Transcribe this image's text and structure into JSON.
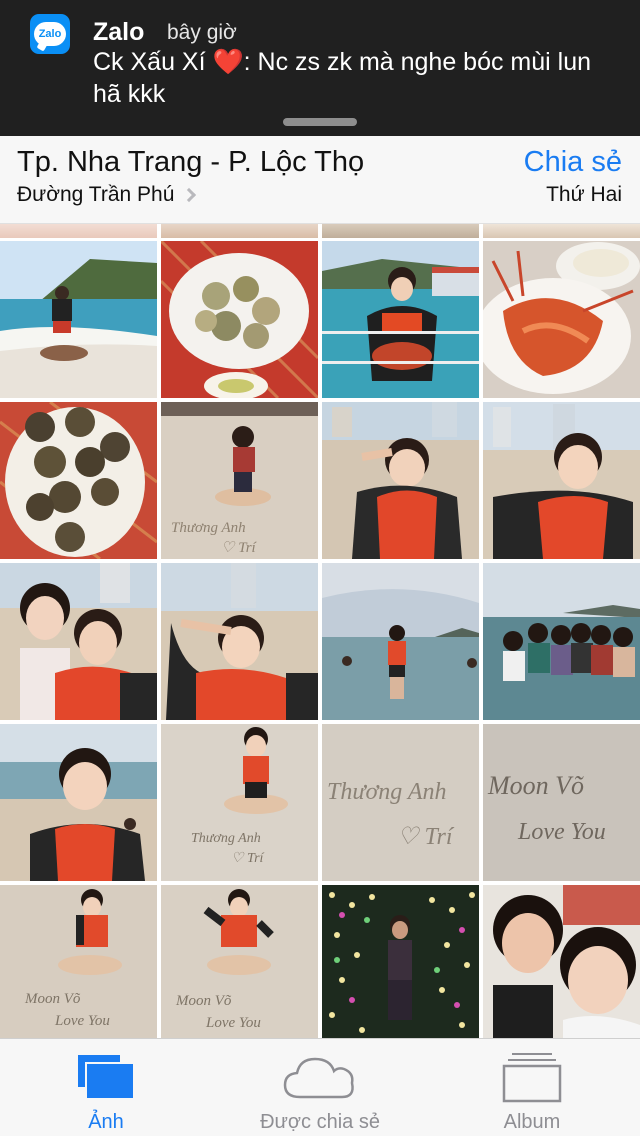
{
  "notification": {
    "app_name": "Zalo",
    "app_icon_text": "Zalo",
    "time": "bây giờ",
    "sender": "Ck Xấu Xí",
    "heart": "❤️",
    "message": ": Nc zs zk mà nghe bóc mùi lun hã kkk"
  },
  "header": {
    "title": "Tp. Nha Trang - P. Lộc Thọ",
    "share_label": "Chia sẻ",
    "street": "Đường Trần Phú",
    "day": "Thứ Hai"
  },
  "photos": [
    {
      "icon": "beach-pose-photo"
    },
    {
      "icon": "seafood-plate-photo"
    },
    {
      "icon": "lobster-boat-photo"
    },
    {
      "icon": "lobster-plate-photo"
    },
    {
      "icon": "sea-urchin-photo"
    },
    {
      "icon": "sand-sitting-photo"
    },
    {
      "icon": "peace-sign-photo"
    },
    {
      "icon": "chin-pose-photo"
    },
    {
      "icon": "friends-selfie-photo"
    },
    {
      "icon": "salute-pose-photo"
    },
    {
      "icon": "sea-standing-photo"
    },
    {
      "icon": "group-sea-photo"
    },
    {
      "icon": "cheek-hands-photo"
    },
    {
      "icon": "sand-writing-pose-photo"
    },
    {
      "icon": "sand-writing-photo"
    },
    {
      "icon": "sand-love-you-photo"
    },
    {
      "icon": "sand-sitting-love-photo"
    },
    {
      "icon": "sand-sitting-love-2-photo"
    },
    {
      "icon": "night-lights-photo"
    },
    {
      "icon": "couple-selfie-photo"
    }
  ],
  "tabs": [
    {
      "label": "Ảnh",
      "icon": "photos-icon",
      "active": true
    },
    {
      "label": "Được chia sẻ",
      "icon": "cloud-icon",
      "active": false
    },
    {
      "label": "Album",
      "icon": "album-icon",
      "active": false
    }
  ],
  "colors": {
    "accent": "#1a7cf2",
    "notification_bg": "#202020",
    "inactive": "#8e8e93"
  }
}
